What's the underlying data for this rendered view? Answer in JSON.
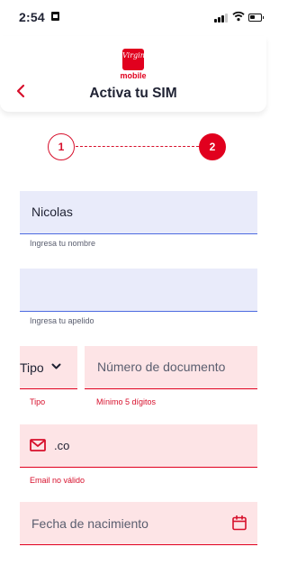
{
  "status_bar": {
    "time": "2:54"
  },
  "header": {
    "logo_text": "Virgin",
    "logo_subtext": "mobile",
    "title": "Activa tu SIM"
  },
  "stepper": {
    "step1": "1",
    "step2": "2"
  },
  "form": {
    "nombre": {
      "value": "Nicolas",
      "helper": "Ingresa tu nombre"
    },
    "apellido": {
      "value": "",
      "helper": "Ingresa tu apelido"
    },
    "tipo": {
      "label": "Tipo",
      "helper": "Tipo"
    },
    "documento": {
      "placeholder": "Número de documento",
      "helper": "Mínimo 5 dígitos"
    },
    "email": {
      "value": ".co",
      "helper": "Email no válido"
    },
    "fecha": {
      "placeholder": "Fecha de nacimiento"
    }
  },
  "colors": {
    "brand_red": "#e1001e",
    "field_blue": "#e9ebfa",
    "field_error": "#fde4e6",
    "underline_blue": "#4d6be0"
  },
  "icons": [
    "back-chevron-icon",
    "mail-icon",
    "calendar-icon",
    "chevron-down-icon",
    "signal-icon",
    "wifi-icon",
    "battery-icon"
  ]
}
